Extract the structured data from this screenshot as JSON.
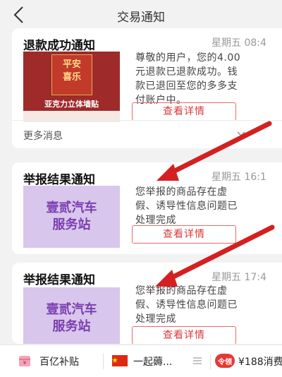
{
  "header": {
    "title": "交易通知"
  },
  "cards": [
    {
      "title": "退款成功通知",
      "time": "星期五 08:4",
      "body_lines": [
        "尊敬的用户，您的4.00",
        "元退款已退款成功。钱",
        "款已退回至您的多多支",
        "付账户中。"
      ],
      "detail": "查看详情",
      "more": "更多消息",
      "poster": {
        "main_line1": "平安",
        "main_line2": "喜乐",
        "subtitle": "亚克力立体墙贴"
      }
    },
    {
      "title": "举报结果通知",
      "time": "星期五 16:1",
      "body_lines": [
        "您举报的商品存在虚",
        "假、诱导性信息问题已",
        "处理完成"
      ],
      "detail": "查看详情",
      "thumb_line1": "壹贰汽车",
      "thumb_line2": "服务站"
    },
    {
      "title": "举报结果通知",
      "time": "星期五 17:4",
      "body_lines": [
        "您举报的商品存在虚",
        "假、诱导性信息问题已",
        "处理完成"
      ],
      "detail": "查看详情",
      "thumb_line1": "壹贰汽车",
      "thumb_line2": "服务站"
    }
  ],
  "bottom": [
    {
      "label": "百亿补贴",
      "icon": "wallet-icon"
    },
    {
      "label": "一起薅...",
      "icon": "flag-icon"
    },
    {
      "label": "¥188消费",
      "icon": "coupon-icon",
      "badge": "令领"
    }
  ],
  "colors": {
    "accent": "#d93b3b",
    "arrow": "#d42020",
    "purple": "#7b3fb0"
  }
}
